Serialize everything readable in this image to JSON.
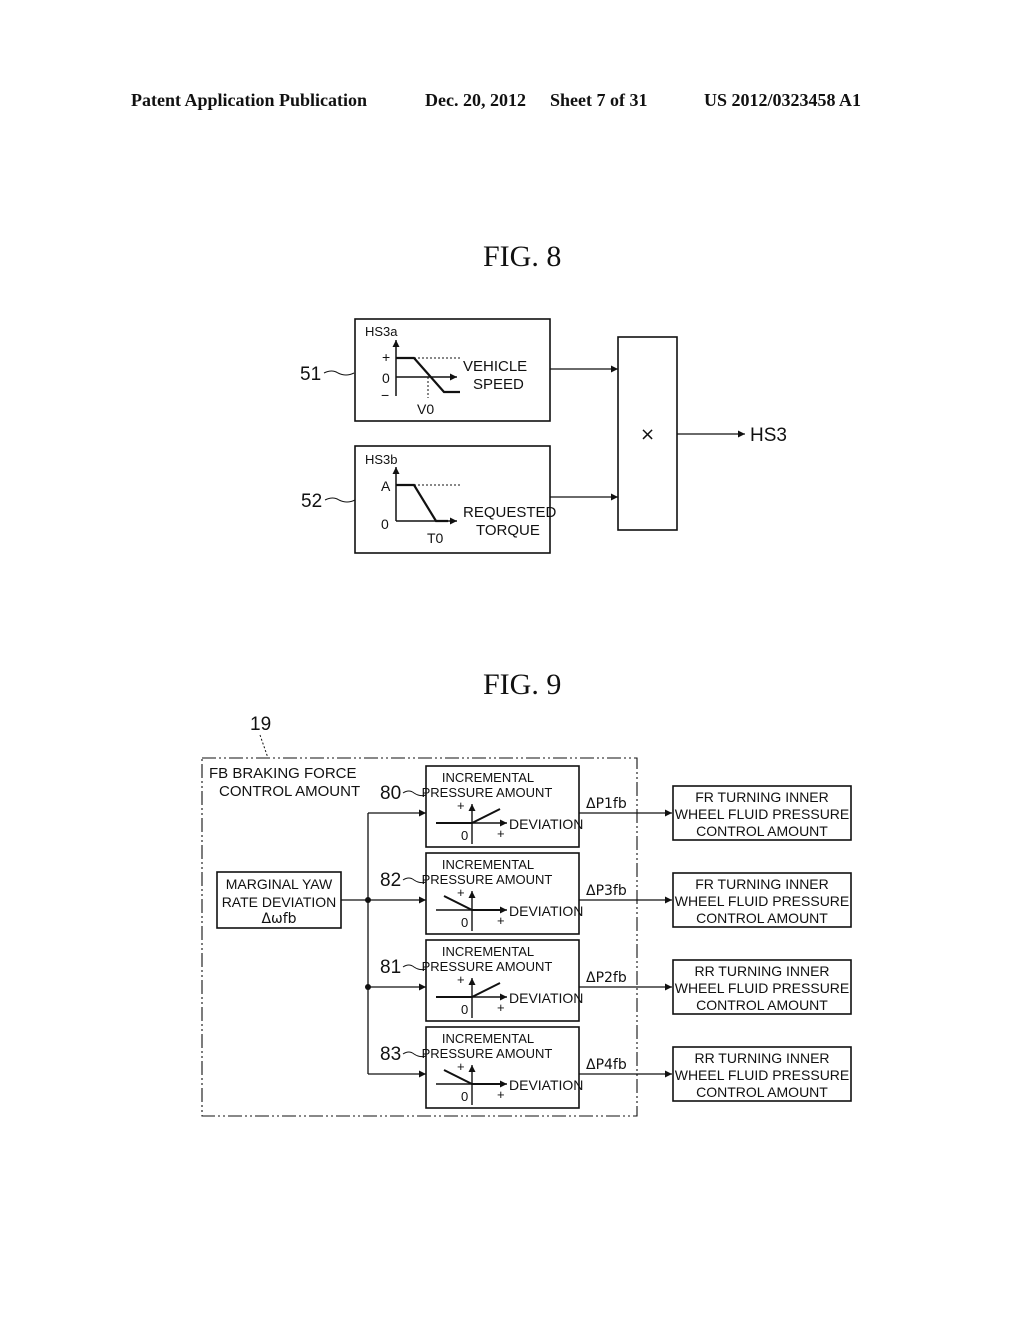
{
  "header": {
    "publication": "Patent Application Publication",
    "date": "Dec. 20, 2012",
    "sheet": "Sheet 7 of 31",
    "number": "US 2012/0323458 A1"
  },
  "fig8": {
    "title": "FIG. 8",
    "block51": {
      "ref": "51",
      "name": "HS3a",
      "y_plus": "+",
      "y_zero": "0",
      "y_minus": "−",
      "x_label_1": "VEHICLE",
      "x_label_2": "SPEED",
      "threshold": "V0"
    },
    "block52": {
      "ref": "52",
      "name": "HS3b",
      "y_top": "A",
      "y_zero": "0",
      "x_label_1": "REQUESTED",
      "x_label_2": "TORQUE",
      "threshold": "T0"
    },
    "multiplier": {
      "symbol": "×"
    },
    "output": "HS3"
  },
  "fig9": {
    "title": "FIG. 9",
    "group_ref": "19",
    "group_label_1": "FB BRAKING FORCE",
    "group_label_2": "CONTROL AMOUNT",
    "input_block": {
      "line1": "MARGINAL YAW",
      "line2": "RATE DEVIATION",
      "line3": "Δωfb"
    },
    "map_blocks": [
      {
        "ref": "80",
        "title_1": "INCREMENTAL",
        "title_2": "PRESSURE AMOUNT",
        "y_plus": "+",
        "zero": "0",
        "x_plus": "+",
        "x_label": "DEVIATION",
        "slope": "increasing",
        "output": "ΔP1fb"
      },
      {
        "ref": "82",
        "title_1": "INCREMENTAL",
        "title_2": "PRESSURE AMOUNT",
        "y_plus": "+",
        "zero": "0",
        "x_plus": "+",
        "x_label": "DEVIATION",
        "slope": "decreasing",
        "output": "ΔP3fb"
      },
      {
        "ref": "81",
        "title_1": "INCREMENTAL",
        "title_2": "PRESSURE AMOUNT",
        "y_plus": "+",
        "zero": "0",
        "x_plus": "+",
        "x_label": "DEVIATION",
        "slope": "increasing",
        "output": "ΔP2fb"
      },
      {
        "ref": "83",
        "title_1": "INCREMENTAL",
        "title_2": "PRESSURE AMOUNT",
        "y_plus": "+",
        "zero": "0",
        "x_plus": "+",
        "x_label": "DEVIATION",
        "slope": "decreasing",
        "output": "ΔP4fb"
      }
    ],
    "output_blocks": [
      {
        "line1": "FR TURNING INNER",
        "line2": "WHEEL FLUID PRESSURE",
        "line3": "CONTROL AMOUNT"
      },
      {
        "line1": "FR TURNING INNER",
        "line2": "WHEEL FLUID PRESSURE",
        "line3": "CONTROL AMOUNT"
      },
      {
        "line1": "RR TURNING INNER",
        "line2": "WHEEL FLUID PRESSURE",
        "line3": "CONTROL AMOUNT"
      },
      {
        "line1": "RR TURNING INNER",
        "line2": "WHEEL FLUID PRESSURE",
        "line3": "CONTROL AMOUNT"
      }
    ]
  }
}
